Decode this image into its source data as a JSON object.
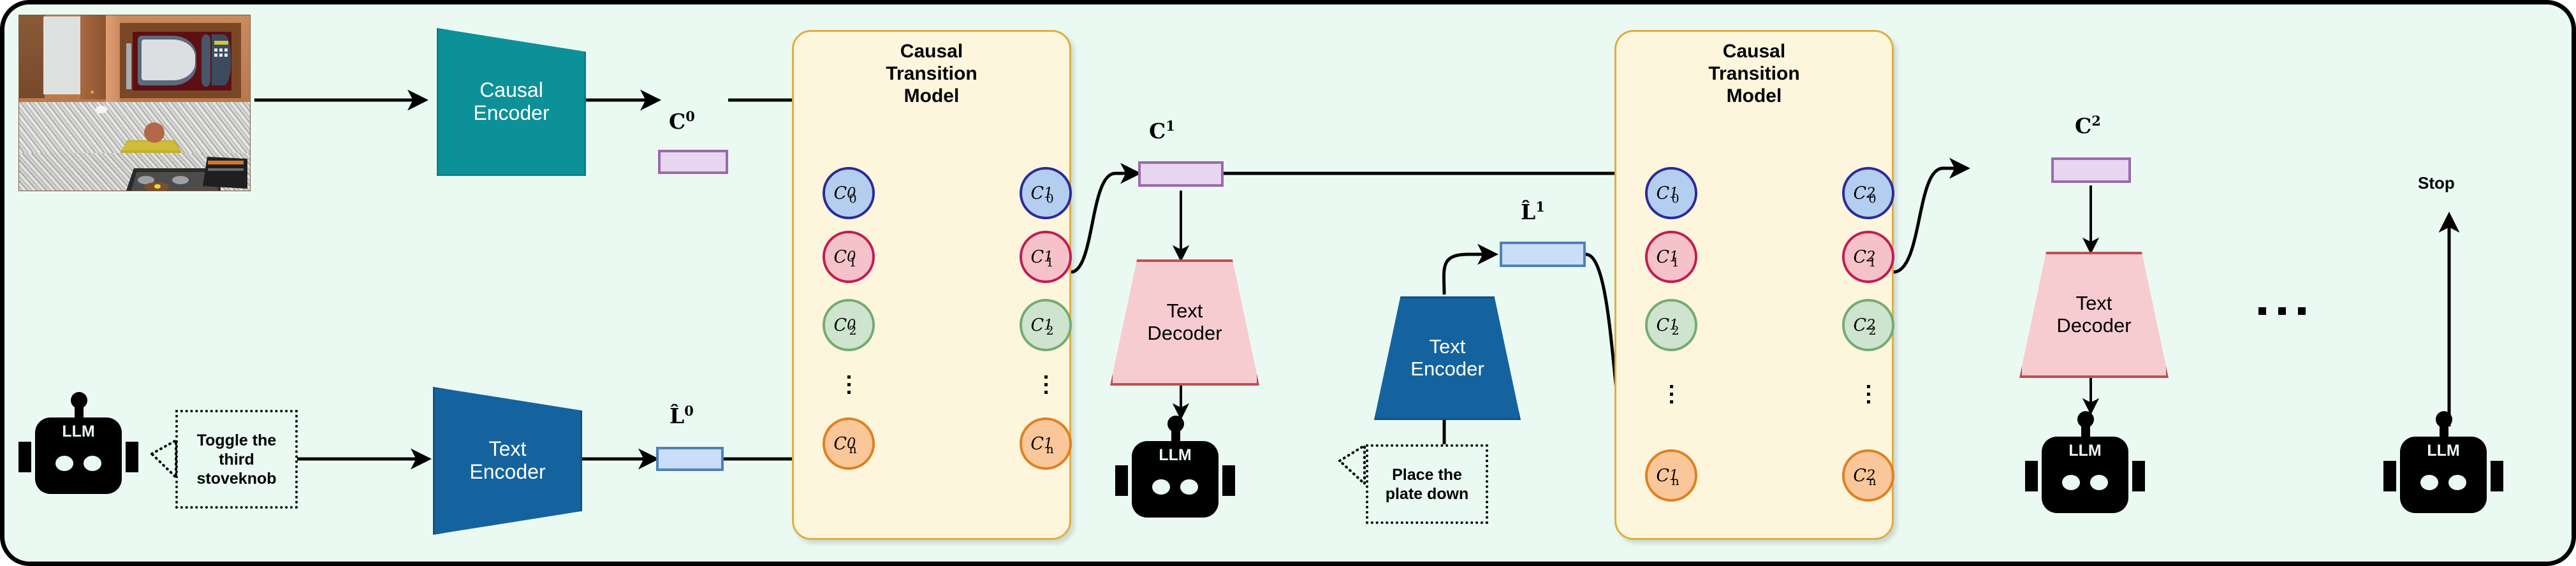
{
  "figure": {
    "background_color": "#eafaf2",
    "border_color": "#000000"
  },
  "scene": {
    "name": "kitchen-observation",
    "description": "AI2-THOR kitchen scene: microwave in cabinet, plate with potato on counter, gas stove"
  },
  "labels": {
    "c0": "C",
    "c0_sup": "0",
    "c1": "C",
    "c1_sup": "1",
    "c2": "C",
    "c2_sup": "2",
    "l0": "L̂",
    "l0_sup": "0",
    "l1": "L̂",
    "l1_sup": "1",
    "stop": "Stop",
    "ellipsis": "..."
  },
  "modules": {
    "causal_encoder": {
      "label": "Causal\nEncoder",
      "fill": "#0d9198",
      "stroke": "#0a7f86",
      "text": "#ffffff"
    },
    "text_encoder": {
      "label": "Text\nEncoder",
      "fill": "#14639f",
      "stroke": "#0f5288",
      "text": "#ffffff"
    },
    "text_decoder": {
      "label": "Text\nDecoder",
      "fill": "#f7ccd0",
      "stroke": "#bf4f4f",
      "text": "#000000"
    },
    "ctm": {
      "title": "Causal\nTransition\nModel",
      "fill": "#fdf6dc",
      "stroke": "#dfae41"
    }
  },
  "bars": {
    "causal": {
      "fill": "#e6d6ef",
      "stroke": "#9b69ae"
    },
    "lang": {
      "fill": "#cadefa",
      "stroke": "#4f81b9"
    }
  },
  "ctm_blocks": [
    {
      "id": "ctm-1",
      "title": "Causal\nTransition\nModel",
      "left_nodes": [
        {
          "base": "C",
          "sub": "0",
          "sup": "0",
          "fill": "#b4cef0",
          "stroke": "#2a2a9c"
        },
        {
          "base": "C",
          "sub": "1",
          "sup": "0",
          "fill": "#f6c2ca",
          "stroke": "#c31b52"
        },
        {
          "base": "C",
          "sub": "2",
          "sup": "0",
          "fill": "#cfe4cf",
          "stroke": "#73ac73"
        },
        {
          "base": "C",
          "sub": "n",
          "sup": "0",
          "fill": "#fac79a",
          "stroke": "#e08020"
        }
      ],
      "right_nodes": [
        {
          "base": "C",
          "sub": "0",
          "sup": "1",
          "fill": "#b4cef0",
          "stroke": "#2a2a9c"
        },
        {
          "base": "C",
          "sub": "1",
          "sup": "1",
          "fill": "#f6c2ca",
          "stroke": "#c31b52"
        },
        {
          "base": "C",
          "sub": "2",
          "sup": "1",
          "fill": "#cfe4cf",
          "stroke": "#73ac73"
        },
        {
          "base": "C",
          "sub": "n",
          "sup": "1",
          "fill": "#fac79a",
          "stroke": "#e08020"
        }
      ]
    },
    {
      "id": "ctm-2",
      "title": "Causal\nTransition\nModel",
      "left_nodes": [
        {
          "base": "C",
          "sub": "0",
          "sup": "1",
          "fill": "#b4cef0",
          "stroke": "#2a2a9c"
        },
        {
          "base": "C",
          "sub": "1",
          "sup": "1",
          "fill": "#f6c2ca",
          "stroke": "#c31b52"
        },
        {
          "base": "C",
          "sub": "2",
          "sup": "1",
          "fill": "#cfe4cf",
          "stroke": "#73ac73"
        },
        {
          "base": "C",
          "sub": "n",
          "sup": "1",
          "fill": "#fac79a",
          "stroke": "#e08020"
        }
      ],
      "right_nodes": [
        {
          "base": "C",
          "sub": "0",
          "sup": "2",
          "fill": "#b4cef0",
          "stroke": "#2a2a9c"
        },
        {
          "base": "C",
          "sub": "1",
          "sup": "2",
          "fill": "#f6c2ca",
          "stroke": "#c31b52"
        },
        {
          "base": "C",
          "sub": "2",
          "sup": "2",
          "fill": "#cfe4cf",
          "stroke": "#73ac73"
        },
        {
          "base": "C",
          "sub": "n",
          "sup": "2",
          "fill": "#fac79a",
          "stroke": "#e08020"
        }
      ]
    }
  ],
  "agents": [
    {
      "id": "llm-1",
      "label": "LLM",
      "instruction": "Toggle the third stoveknob"
    },
    {
      "id": "llm-2",
      "label": "LLM",
      "instruction": "Place the plate down"
    },
    {
      "id": "llm-3",
      "label": "LLM",
      "instruction": ""
    },
    {
      "id": "llm-4",
      "label": "LLM",
      "instruction": ""
    }
  ]
}
